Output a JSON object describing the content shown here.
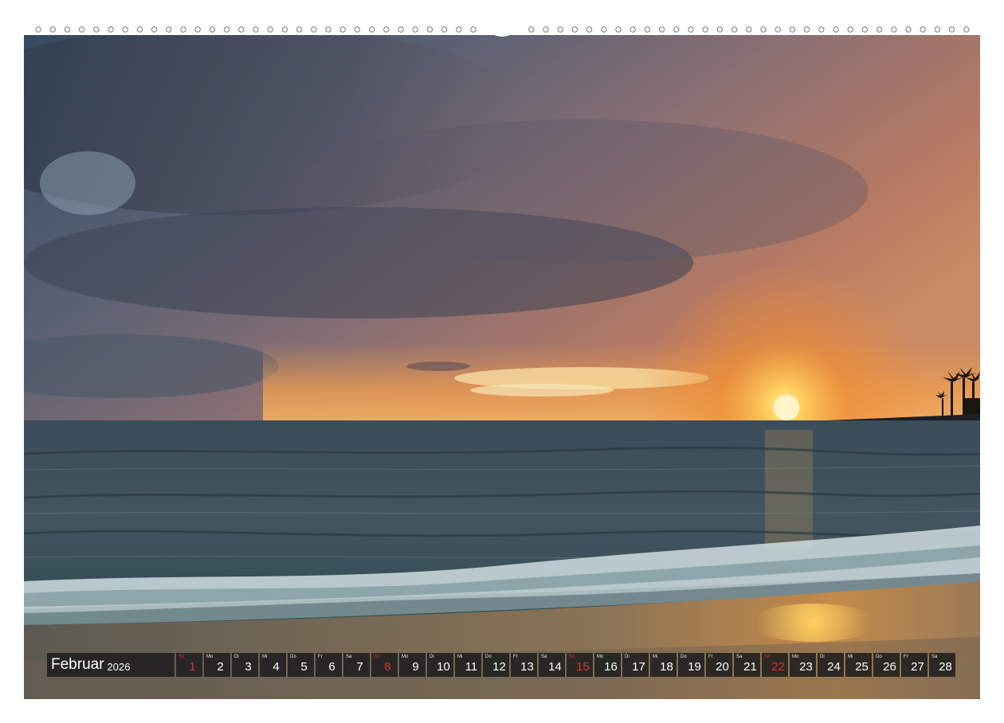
{
  "calendar": {
    "month": "Februar",
    "year": "2026",
    "days": [
      {
        "abbr": "So",
        "num": "1",
        "sunday": true
      },
      {
        "abbr": "Mo",
        "num": "2",
        "sunday": false
      },
      {
        "abbr": "Di",
        "num": "3",
        "sunday": false
      },
      {
        "abbr": "Mi",
        "num": "4",
        "sunday": false
      },
      {
        "abbr": "Do",
        "num": "5",
        "sunday": false
      },
      {
        "abbr": "Fr",
        "num": "6",
        "sunday": false
      },
      {
        "abbr": "Sa",
        "num": "7",
        "sunday": false
      },
      {
        "abbr": "So",
        "num": "8",
        "sunday": true
      },
      {
        "abbr": "Mo",
        "num": "9",
        "sunday": false
      },
      {
        "abbr": "Di",
        "num": "10",
        "sunday": false
      },
      {
        "abbr": "Mi",
        "num": "11",
        "sunday": false
      },
      {
        "abbr": "Do",
        "num": "12",
        "sunday": false
      },
      {
        "abbr": "Fr",
        "num": "13",
        "sunday": false
      },
      {
        "abbr": "Sa",
        "num": "14",
        "sunday": false
      },
      {
        "abbr": "So",
        "num": "15",
        "sunday": true
      },
      {
        "abbr": "Mo",
        "num": "16",
        "sunday": false
      },
      {
        "abbr": "Di",
        "num": "17",
        "sunday": false
      },
      {
        "abbr": "Mi",
        "num": "18",
        "sunday": false
      },
      {
        "abbr": "Do",
        "num": "19",
        "sunday": false
      },
      {
        "abbr": "Fr",
        "num": "20",
        "sunday": false
      },
      {
        "abbr": "Sa",
        "num": "21",
        "sunday": false
      },
      {
        "abbr": "So",
        "num": "22",
        "sunday": true
      },
      {
        "abbr": "Mo",
        "num": "23",
        "sunday": false
      },
      {
        "abbr": "Di",
        "num": "24",
        "sunday": false
      },
      {
        "abbr": "Mi",
        "num": "25",
        "sunday": false
      },
      {
        "abbr": "Do",
        "num": "26",
        "sunday": false
      },
      {
        "abbr": "Fr",
        "num": "27",
        "sunday": false
      },
      {
        "abbr": "Sa",
        "num": "28",
        "sunday": false
      }
    ]
  },
  "colors": {
    "sunday_red": "#e03030",
    "bar_background": "#1e1e1e"
  }
}
